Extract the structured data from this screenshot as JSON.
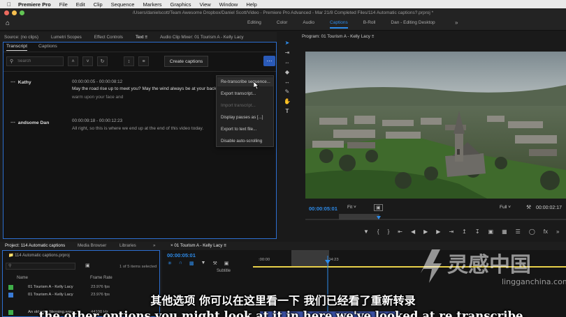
{
  "menubar": {
    "app": "Premiere Pro",
    "items": [
      "File",
      "Edit",
      "Clip",
      "Sequence",
      "Markers",
      "Graphics",
      "View",
      "Window",
      "Help"
    ]
  },
  "window": {
    "title": "/Users/danielscott/Team Awesome Dropbox/Daniel Scott/Video - Premiere Pro Advanced - Mar 21/8 Completed Files/114 Automatic captions?.prproj *"
  },
  "workspaces": {
    "tabs": [
      "Editing",
      "Color",
      "Audio",
      "Captions",
      "B-Roll",
      "Dan - Editing Desktop"
    ],
    "active": "Captions"
  },
  "panel_tabs": {
    "source": "Source: (no clips)",
    "lumetri": "Lumetri Scopes",
    "effect_controls": "Effect Controls",
    "text": "Text",
    "audio_mixer": "Audio Clip Mixer: 01 Tourism A - Kelly Lacy"
  },
  "text_panel": {
    "tabs": [
      "Transcript",
      "Captions"
    ],
    "search_placeholder": "Search",
    "create_captions": "Create captions",
    "entries": [
      {
        "speaker": "Kathy",
        "timecode": "00:00:00:05 - 00:00:08:12",
        "line1": "May the road rise up to meet you? May the wind always be at your back",
        "line2": "warm upon your face and"
      },
      {
        "speaker": "andsome Dan",
        "timecode": "00:00:09:18 - 00:00:12:23",
        "line1": "All right, so this is where we end up at the end of this video today.",
        "line2": ""
      }
    ]
  },
  "context_menu": {
    "items": [
      {
        "label": "Re-transcribe sequence...",
        "enabled": true
      },
      {
        "label": "Export transcript...",
        "enabled": true
      },
      {
        "label": "Import transcript...",
        "enabled": false
      },
      {
        "label": "Display pauses as [...]",
        "enabled": true
      },
      {
        "label": "Export to text file...",
        "enabled": true
      },
      {
        "label": "Disable auto-scrolling",
        "enabled": true
      }
    ]
  },
  "program_monitor": {
    "title": "Program: 01 Tourism A - Kelly Lacy",
    "timecode": "00:00:05:01",
    "fit": "Fit",
    "quality": "Full",
    "duration": "00:00:02:17"
  },
  "project_panel": {
    "tabs": [
      "Project: 114 Automatic captions",
      "Media Browser",
      "Libraries"
    ],
    "file": "114 Automatic captions.prproj",
    "selection": "1 of 5 items selected",
    "col_name": "Name",
    "col_rate": "Frame Rate",
    "items": [
      {
        "name": "01 Tourism A - Kelly Lacy",
        "rate": "23.976 fps",
        "color": "#3fae49"
      },
      {
        "name": "01 Tourism A - Kelly Lacy",
        "rate": "23.976 fps",
        "color": "#3a7bd5"
      },
      {
        "name": "An old Irish blessing.wav",
        "rate": "44100 Hz",
        "color": "#3fae49"
      }
    ]
  },
  "timeline": {
    "tab": "01 Tourism A - Kelly Lacy",
    "timecode": "00:00:05:01",
    "subtitle_track": "Subtitle",
    "ruler_start": ":00:00",
    "ruler_mid": "00:00:04:23"
  },
  "subtitles": {
    "zh": "其他选项 你可以在这里看一下 我们已经看了重新转录",
    "en": "the other options you might look at it in here we've looked at re transcribe."
  },
  "watermark": {
    "cn": "灵感中国",
    "url": "lingganchina.com"
  }
}
